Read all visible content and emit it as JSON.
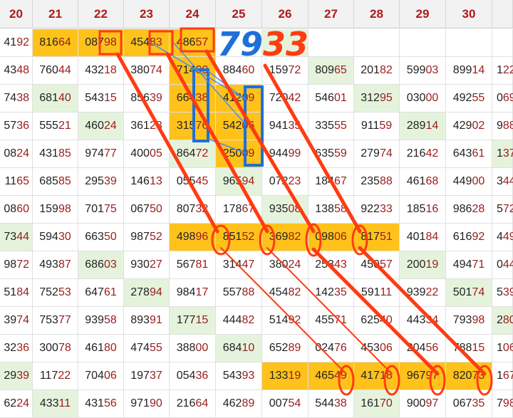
{
  "columns": [
    "20",
    "21",
    "22",
    "23",
    "24",
    "25",
    "26",
    "27",
    "28",
    "29",
    "30",
    ""
  ],
  "rows": [
    [
      [
        "4192",
        ""
      ],
      [
        "81664",
        "y"
      ],
      [
        "08798",
        "y"
      ],
      [
        "45483",
        "y"
      ],
      [
        "48657",
        "y"
      ],
      [
        "",
        ""
      ],
      [
        "",
        "g"
      ],
      [
        "",
        ""
      ],
      [
        "",
        ""
      ],
      [
        "",
        ""
      ],
      [
        "",
        ""
      ],
      [
        "",
        ""
      ]
    ],
    [
      [
        "4348",
        ""
      ],
      [
        "76044",
        ""
      ],
      [
        "43218",
        ""
      ],
      [
        "38074",
        ""
      ],
      [
        "71400",
        "y"
      ],
      [
        "88460",
        ""
      ],
      [
        "15972",
        ""
      ],
      [
        "80965",
        "g"
      ],
      [
        "20182",
        ""
      ],
      [
        "59903",
        ""
      ],
      [
        "89914",
        ""
      ],
      [
        "122",
        ""
      ]
    ],
    [
      [
        "7438",
        ""
      ],
      [
        "68140",
        "g"
      ],
      [
        "54315",
        ""
      ],
      [
        "85639",
        ""
      ],
      [
        "66438",
        "y"
      ],
      [
        "41209",
        "y"
      ],
      [
        "72042",
        ""
      ],
      [
        "54601",
        ""
      ],
      [
        "31295",
        "g"
      ],
      [
        "03000",
        ""
      ],
      [
        "49255",
        ""
      ],
      [
        "069",
        ""
      ]
    ],
    [
      [
        "5736",
        ""
      ],
      [
        "55521",
        ""
      ],
      [
        "46024",
        "g"
      ],
      [
        "36123",
        ""
      ],
      [
        "31576",
        "y"
      ],
      [
        "54206",
        "y"
      ],
      [
        "94135",
        ""
      ],
      [
        "33555",
        ""
      ],
      [
        "91159",
        ""
      ],
      [
        "28914",
        "g"
      ],
      [
        "42902",
        ""
      ],
      [
        "988",
        ""
      ]
    ],
    [
      [
        "0824",
        ""
      ],
      [
        "43185",
        ""
      ],
      [
        "97477",
        ""
      ],
      [
        "40005",
        ""
      ],
      [
        "86472",
        "g"
      ],
      [
        "25009",
        "y"
      ],
      [
        "94499",
        ""
      ],
      [
        "63559",
        ""
      ],
      [
        "27974",
        ""
      ],
      [
        "21642",
        ""
      ],
      [
        "64361",
        ""
      ],
      [
        "137",
        "g"
      ]
    ],
    [
      [
        "1165",
        ""
      ],
      [
        "68585",
        ""
      ],
      [
        "29539",
        ""
      ],
      [
        "14613",
        ""
      ],
      [
        "05545",
        ""
      ],
      [
        "96594",
        "g"
      ],
      [
        "07223",
        ""
      ],
      [
        "18467",
        ""
      ],
      [
        "23588",
        ""
      ],
      [
        "46168",
        ""
      ],
      [
        "44900",
        ""
      ],
      [
        "344",
        ""
      ]
    ],
    [
      [
        "0860",
        ""
      ],
      [
        "15998",
        ""
      ],
      [
        "70175",
        ""
      ],
      [
        "06750",
        ""
      ],
      [
        "80732",
        ""
      ],
      [
        "17867",
        ""
      ],
      [
        "93508",
        "g"
      ],
      [
        "13858",
        ""
      ],
      [
        "92233",
        ""
      ],
      [
        "18516",
        ""
      ],
      [
        "98628",
        ""
      ],
      [
        "572",
        ""
      ]
    ],
    [
      [
        "7344",
        "g"
      ],
      [
        "59430",
        ""
      ],
      [
        "66350",
        ""
      ],
      [
        "98752",
        ""
      ],
      [
        "49896",
        "y"
      ],
      [
        "85152",
        "y"
      ],
      [
        "36982",
        "y"
      ],
      [
        "09806",
        "y"
      ],
      [
        "81751",
        "y"
      ],
      [
        "40184",
        ""
      ],
      [
        "61692",
        ""
      ],
      [
        "449",
        ""
      ]
    ],
    [
      [
        "9872",
        ""
      ],
      [
        "49387",
        ""
      ],
      [
        "68603",
        "g"
      ],
      [
        "93027",
        ""
      ],
      [
        "56781",
        ""
      ],
      [
        "31447",
        ""
      ],
      [
        "38024",
        ""
      ],
      [
        "25343",
        ""
      ],
      [
        "45057",
        ""
      ],
      [
        "20019",
        "g"
      ],
      [
        "49471",
        ""
      ],
      [
        "044",
        ""
      ]
    ],
    [
      [
        "5184",
        ""
      ],
      [
        "75253",
        ""
      ],
      [
        "64761",
        ""
      ],
      [
        "27894",
        "g"
      ],
      [
        "98417",
        ""
      ],
      [
        "55788",
        ""
      ],
      [
        "45482",
        ""
      ],
      [
        "14235",
        ""
      ],
      [
        "59111",
        ""
      ],
      [
        "93922",
        ""
      ],
      [
        "50174",
        "g"
      ],
      [
        "539",
        ""
      ]
    ],
    [
      [
        "3974",
        ""
      ],
      [
        "75377",
        ""
      ],
      [
        "93958",
        ""
      ],
      [
        "89391",
        ""
      ],
      [
        "17715",
        "g"
      ],
      [
        "44482",
        ""
      ],
      [
        "51492",
        ""
      ],
      [
        "45571",
        ""
      ],
      [
        "62540",
        ""
      ],
      [
        "44334",
        ""
      ],
      [
        "79398",
        ""
      ],
      [
        "280",
        "g"
      ]
    ],
    [
      [
        "3236",
        ""
      ],
      [
        "30078",
        ""
      ],
      [
        "46180",
        ""
      ],
      [
        "47455",
        ""
      ],
      [
        "38800",
        ""
      ],
      [
        "68410",
        "g"
      ],
      [
        "65289",
        ""
      ],
      [
        "02476",
        ""
      ],
      [
        "45306",
        ""
      ],
      [
        "20456",
        ""
      ],
      [
        "78815",
        ""
      ],
      [
        "106",
        ""
      ]
    ],
    [
      [
        "2939",
        "g"
      ],
      [
        "11722",
        ""
      ],
      [
        "70406",
        ""
      ],
      [
        "19737",
        ""
      ],
      [
        "05436",
        ""
      ],
      [
        "54393",
        ""
      ],
      [
        "13319",
        "y"
      ],
      [
        "46549",
        "y"
      ],
      [
        "41718",
        "y"
      ],
      [
        "96797",
        "y"
      ],
      [
        "82073",
        "y"
      ],
      [
        "167",
        ""
      ]
    ],
    [
      [
        "6224",
        ""
      ],
      [
        "43311",
        "g"
      ],
      [
        "43156",
        ""
      ],
      [
        "97190",
        ""
      ],
      [
        "21664",
        ""
      ],
      [
        "46289",
        ""
      ],
      [
        "00754",
        ""
      ],
      [
        "54438",
        ""
      ],
      [
        "16170",
        "g"
      ],
      [
        "90097",
        ""
      ],
      [
        "06735",
        ""
      ],
      [
        "798",
        ""
      ]
    ]
  ],
  "annotation": {
    "text": "7933",
    "colors": {
      "blue": "#1e6fd9",
      "red": "#ff3b12"
    }
  },
  "colors": {
    "header_text": "#b01818",
    "yellow": "#ffc21b",
    "green": "#e5f3dc"
  }
}
